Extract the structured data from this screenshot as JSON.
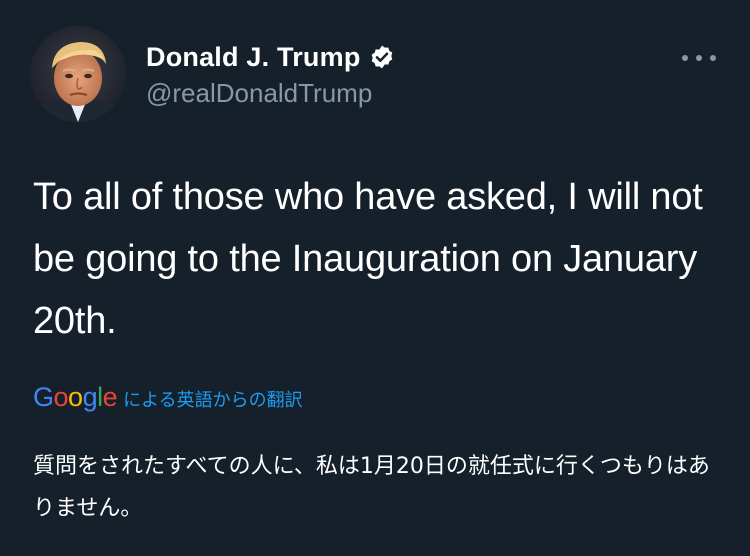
{
  "author": {
    "display_name": "Donald J. Trump",
    "handle": "@realDonaldTrump",
    "verified": true
  },
  "tweet": {
    "text": "To all of those who have asked, I will not be going to the Inauguration on January 20th."
  },
  "translation": {
    "provider_letters": [
      "G",
      "o",
      "o",
      "g",
      "l",
      "e"
    ],
    "provider_colors": [
      "#4285f4",
      "#ea4335",
      "#fbbc05",
      "#4285f4",
      "#34a853",
      "#ea4335"
    ],
    "label": "による英語からの翻訳",
    "text": "質問をされたすべての人に、私は1月20日の就任式に行くつもりはありません。"
  },
  "icons": {
    "verified": "verified-badge-icon",
    "more": "more-options-icon"
  },
  "colors": {
    "background": "#15202b",
    "primary_text": "#ffffff",
    "secondary_text": "#8899a6",
    "link": "#1d9bf0"
  }
}
